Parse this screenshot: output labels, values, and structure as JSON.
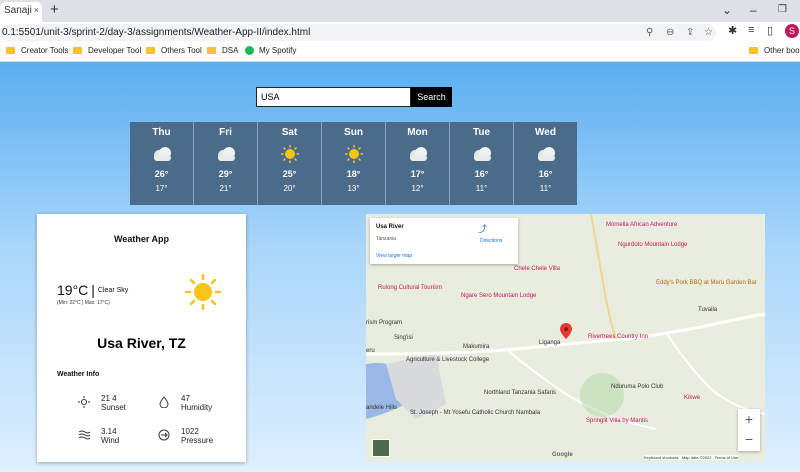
{
  "browser": {
    "tab_title": "Sanaji",
    "tab_close": "×",
    "new_tab": "+",
    "url": "0.1:5501/unit-3/sprint-2/day-3/assignments/Weather-App-II/index.html",
    "profile_initial": "S",
    "bookmarks": [
      "Creator Tools",
      "Developer Tool",
      "Others Tool",
      "DSA",
      "My Spotify"
    ],
    "other_bookmarks": "Other book"
  },
  "search": {
    "value": "USA",
    "button_label": "Search"
  },
  "forecast": [
    {
      "day": "Thu",
      "high": "26°",
      "low": "17°",
      "icon": "cloud-icon"
    },
    {
      "day": "Fri",
      "high": "29°",
      "low": "21°",
      "icon": "cloud-icon"
    },
    {
      "day": "Sat",
      "high": "25°",
      "low": "20°",
      "icon": "sun-icon"
    },
    {
      "day": "Sun",
      "high": "18°",
      "low": "13°",
      "icon": "sun-icon"
    },
    {
      "day": "Mon",
      "high": "17°",
      "low": "12°",
      "icon": "cloud-icon"
    },
    {
      "day": "Tue",
      "high": "16°",
      "low": "11°",
      "icon": "cloud-icon"
    },
    {
      "day": "Wed",
      "high": "16°",
      "low": "11°",
      "icon": "cloud-icon"
    }
  ],
  "card": {
    "title": "Weather App",
    "temperature": "19°C",
    "separator": "|",
    "description": "Clear Sky",
    "minmax": "(Min: 22°C | Max: 17°C)",
    "city": "Usa River, TZ",
    "info_title": "Weather Info",
    "stats": {
      "sunset": {
        "value": "21   4",
        "label": "Sunset",
        "icon": "sunset-icon"
      },
      "humidity": {
        "value": "47",
        "label": "Humidity",
        "icon": "droplet-icon"
      },
      "wind": {
        "value": "3.14",
        "label": "Wind",
        "icon": "wind-icon"
      },
      "pressure": {
        "value": "1022",
        "label": "Pressure",
        "icon": "pressure-icon"
      }
    }
  },
  "map": {
    "place": "Usa River",
    "region": "Tanzania",
    "directions": "Directions",
    "larger_map": "View larger map",
    "zoom_in": "+",
    "zoom_out": "−",
    "footer": [
      "Keyboard shortcuts",
      "Map data ©2022",
      "Terms of Use"
    ],
    "google": "Google",
    "labels": {
      "momella": "Momella African Adventure",
      "ngurdoto": "Ngurdoto Mountain Lodge",
      "chele": "Chele Chele Villa",
      "tuvaila": "Tuvaila",
      "eddys": "Eddy's Pork BBQ at Meru Garden Bar",
      "rulong": "Rulong Cultural Tourism",
      "ngare": "Ngare Sero Mountain Lodge",
      "tourism": "rism Program",
      "singisi": "Sing'isi",
      "makumira": "Makumira",
      "liganga": "Liganga",
      "rivertrees": "Rivertrees Country Inn",
      "agric": "Agriculture & Livestock College",
      "northland": "Northland Tanzania Safaris",
      "nduruma": "Nduruma Polo Club",
      "kikwe": "Kikwe",
      "joseph": "St. Joseph - Mt Yosefu Catholic Church Nambala",
      "springlit": "Springlit Villa by Mantis",
      "andele": "andele Hills",
      "meru": "eru"
    }
  },
  "colors": {
    "forecast_bg": "#4a6b89",
    "sun": "#f5c518",
    "accent_pink": "#c2185b"
  }
}
